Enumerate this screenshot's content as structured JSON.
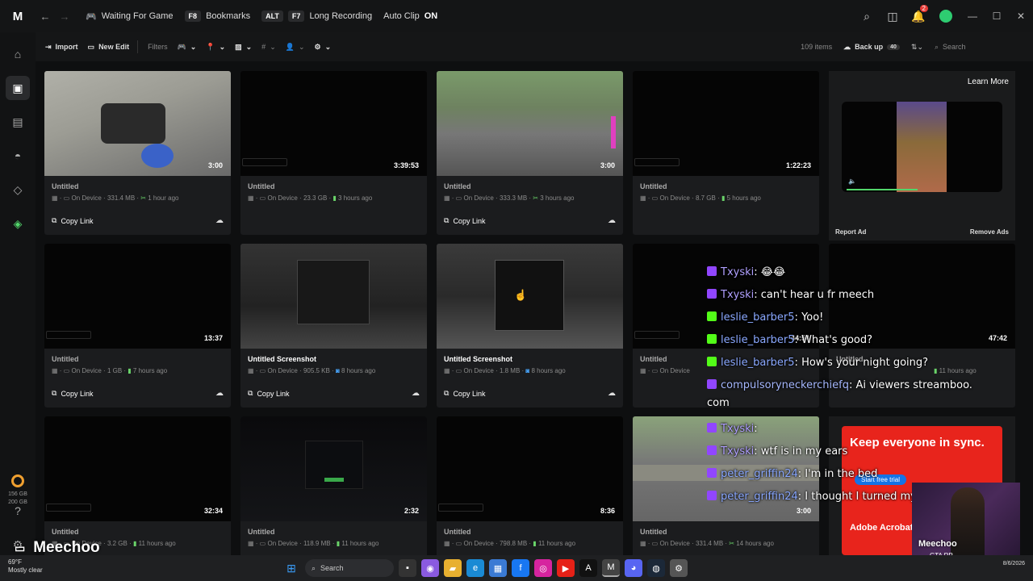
{
  "titlebar": {
    "logo": "M",
    "status": "Waiting For Game",
    "bookmarks_key": "F8",
    "bookmarks_label": "Bookmarks",
    "long_key_1": "ALT",
    "long_key_2": "F7",
    "long_label": "Long Recording",
    "autoclip_label": "Auto Clip",
    "autoclip_value": "ON",
    "notification_count": "2"
  },
  "toolbar": {
    "import_label": "Import",
    "new_edit_label": "New Edit",
    "filters_label": "Filters",
    "items_count": "109 items",
    "backup_label": "Back up",
    "backup_count": "40",
    "search_placeholder": "Search"
  },
  "sidebar": {
    "storage_used": "156 GB",
    "storage_total": "200 GB"
  },
  "cards": [
    {
      "duration": "3:00",
      "title": "Untitled",
      "device": "On Device",
      "size": "331.4 MB",
      "time": "1 hour ago",
      "copy": "Copy Link"
    },
    {
      "duration": "3:39:53",
      "title": "Untitled",
      "device": "On Device",
      "size": "23.3 GB",
      "time": "3 hours ago",
      "copy": ""
    },
    {
      "duration": "3:00",
      "title": "Untitled",
      "device": "On Device",
      "size": "333.3 MB",
      "time": "3 hours ago",
      "copy": "Copy Link"
    },
    {
      "duration": "1:22:23",
      "title": "Untitled",
      "device": "On Device",
      "size": "8.7 GB",
      "time": "5 hours ago",
      "copy": ""
    },
    {
      "duration": "13:37",
      "title": "Untitled",
      "device": "On Device",
      "size": "1 GB",
      "time": "7 hours ago",
      "copy": "Copy Link"
    },
    {
      "duration": "",
      "title": "Untitled Screenshot",
      "device": "On Device",
      "size": "905.5 KB",
      "time": "8 hours ago",
      "copy": "Copy Link"
    },
    {
      "duration": "",
      "title": "Untitled Screenshot",
      "device": "On Device",
      "size": "1.8 MB",
      "time": "8 hours ago",
      "copy": "Copy Link"
    },
    {
      "duration": "44:54",
      "title": "Untitled",
      "device": "On Device",
      "size": "",
      "time": "",
      "copy": ""
    },
    {
      "duration": "47:42",
      "title": "Untitled",
      "device": "",
      "size": "",
      "time": "11 hours ago",
      "copy": ""
    },
    {
      "duration": "32:34",
      "title": "Untitled",
      "device": "On Device",
      "size": "3.2 GB",
      "time": "11 hours ago",
      "copy": ""
    },
    {
      "duration": "2:32",
      "title": "Untitled",
      "device": "On Device",
      "size": "118.9 MB",
      "time": "11 hours ago",
      "copy": ""
    },
    {
      "duration": "8:36",
      "title": "Untitled",
      "device": "On Device",
      "size": "798.8 MB",
      "time": "11 hours ago",
      "copy": ""
    },
    {
      "duration": "3:00",
      "title": "Untitled",
      "device": "On Device",
      "size": "331.4 MB",
      "time": "14 hours ago",
      "copy": ""
    }
  ],
  "ad": {
    "learn_more": "Learn More",
    "report": "Report Ad",
    "remove": "Remove Ads"
  },
  "ad2": {
    "headline": "Keep everyone in sync.",
    "button": "Start free trial",
    "brand": "Adobe Acrobat Stud"
  },
  "chat": [
    {
      "user": "Txyski",
      "text": "😂😂",
      "platform": "twitch",
      "user_color": "#b0a0ff"
    },
    {
      "user": "Txyski",
      "text": "can't hear u fr meech",
      "platform": "twitch",
      "user_color": "#b0a0ff"
    },
    {
      "user": "leslie_barber5",
      "text": "Yoo!",
      "platform": "kick",
      "user_color": "#8aa8ff"
    },
    {
      "user": "leslie_barber5",
      "text": "What's good?",
      "platform": "kick",
      "user_color": "#8aa8ff"
    },
    {
      "user": "leslie_barber5",
      "text": "How's your night going?",
      "platform": "kick",
      "user_color": "#8aa8ff"
    },
    {
      "user": "compulsoryneckerchiefq",
      "text": "Ai viewers streamboo.",
      "platform": "twitch",
      "user_color": "#a6b8ff"
    },
    {
      "user": "",
      "text": "com",
      "platform": "",
      "user_color": "#ffffff"
    },
    {
      "user": "Txyski",
      "text": "",
      "platform": "twitch",
      "user_color": "#b0a0ff"
    },
    {
      "user": "Txyski",
      "text": "wtf is in my ears",
      "platform": "twitch",
      "user_color": "#b0a0ff"
    },
    {
      "user": "peter_griffin24",
      "text": "I'm in the bed",
      "platform": "twitch",
      "user_color": "#8aa8ff"
    },
    {
      "user": "peter_griffin24",
      "text": "I thought I turned my shut off",
      "platform": "twitch",
      "user_color": "#8aa8ff"
    }
  ],
  "cam": {
    "name": "Meechoo",
    "sub": "GTA RP"
  },
  "streamer_name": "Meechoo",
  "taskbar": {
    "temp": "69°F",
    "weather": "Mostly clear",
    "search": "Search",
    "date": "8/6/2026"
  }
}
